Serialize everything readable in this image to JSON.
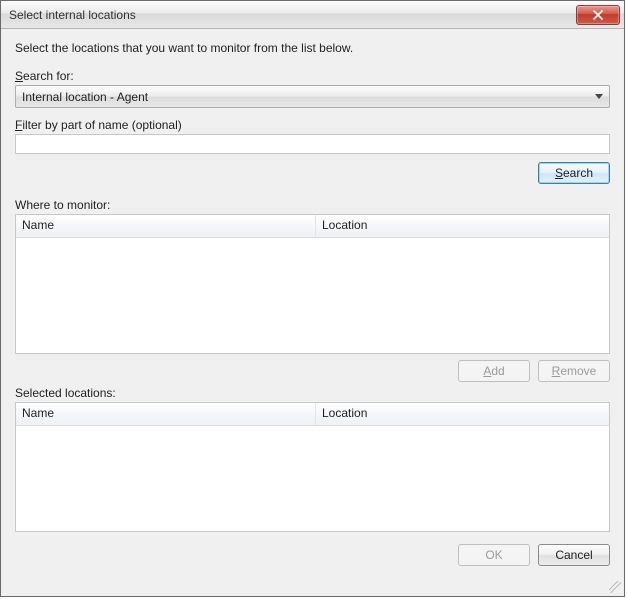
{
  "window": {
    "title": "Select internal locations"
  },
  "intro": "Select the locations that you want to monitor from the list below.",
  "search": {
    "label_prefix": "S",
    "label_rest": "earch for:",
    "dropdown_value": "Internal location - Agent",
    "filter_label_prefix": "F",
    "filter_label_rest": "ilter by part of name (optional)",
    "filter_value": "",
    "button_prefix": "S",
    "button_rest": "earch"
  },
  "monitor": {
    "label": "Where to monitor:",
    "columns": {
      "name": "Name",
      "location": "Location"
    },
    "rows": []
  },
  "actions": {
    "add_prefix": "A",
    "add_rest": "dd",
    "remove_prefix": "R",
    "remove_rest": "emove"
  },
  "selected": {
    "label": "Selected locations:",
    "columns": {
      "name": "Name",
      "location": "Location"
    },
    "rows": []
  },
  "footer": {
    "ok": "OK",
    "cancel": "Cancel"
  }
}
